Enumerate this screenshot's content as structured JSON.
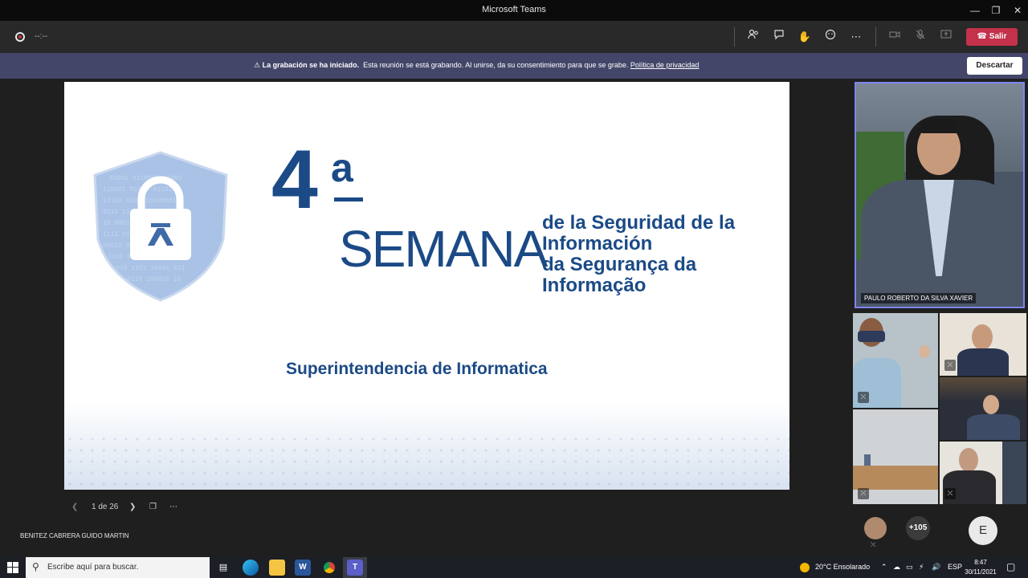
{
  "window": {
    "title": "Microsoft Teams"
  },
  "toolbar": {
    "timer": "--:--",
    "leave_label": "Salir"
  },
  "banner": {
    "title": "La grabación se ha iniciado.",
    "message": "Esta reunión se está grabando. Al unirse, da su consentimiento para que se grabe.",
    "link": "Política de privacidad",
    "dismiss_label": "Descartar"
  },
  "slide": {
    "number": "4",
    "ordinal": "a",
    "word": "SEMANA",
    "subtitle_lines": [
      "de la Seguridad de la",
      "Información",
      "da Segurança da",
      "Informação"
    ],
    "footer": "Superintendencia de Informatica",
    "colors": {
      "primary": "#1b4a86",
      "shield": "#8fb0dd"
    }
  },
  "slide_nav": {
    "page": "1 de 26"
  },
  "presenter": {
    "name": "BENITEZ CABRERA GUIDO MARTIN"
  },
  "participants": {
    "featured_name": "PAULO ROBERTO DA SILVA XAVIER",
    "more_count": "+105",
    "avatar_initial": "E"
  },
  "taskbar": {
    "search_placeholder": "Escribe aquí para buscar.",
    "weather": "20°C  Ensolarado",
    "language": "ESP",
    "time": "8:47",
    "date": "30/11/2021"
  }
}
